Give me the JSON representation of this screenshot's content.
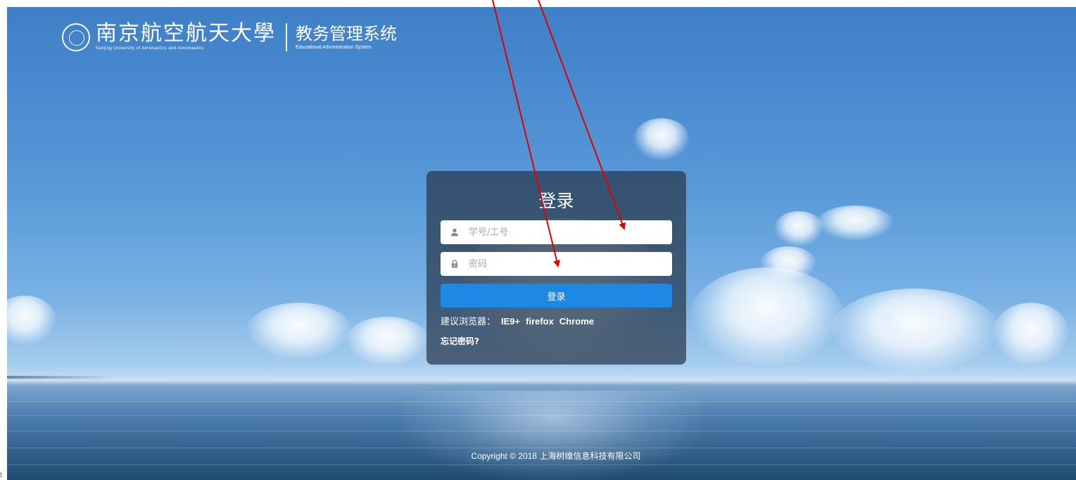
{
  "header": {
    "university_cn": "南京航空航天大學",
    "university_en": "Nanjing University of Aeronautics and Astronautics",
    "system_cn": "教务管理系统",
    "system_en": "Educational Administration System"
  },
  "login": {
    "title": "登录",
    "username": {
      "placeholder": "学号/工号",
      "value": "",
      "icon": "user-icon"
    },
    "password": {
      "placeholder": "密码",
      "value": "",
      "icon": "lock-icon"
    },
    "submit_label": "登录",
    "browser_hint_label": "建议浏览器：",
    "browsers": [
      "IE9+",
      "firefox",
      "Chrome"
    ],
    "forgot_label": "忘记密码?"
  },
  "footer": {
    "copyright": "Copyright © 2018 上海树维信息科技有限公司"
  },
  "corner_text": "t",
  "colors": {
    "button": "#1e88e5",
    "panel": "rgba(40,55,75,0.72)",
    "annotation_arrow": "#e00000"
  }
}
